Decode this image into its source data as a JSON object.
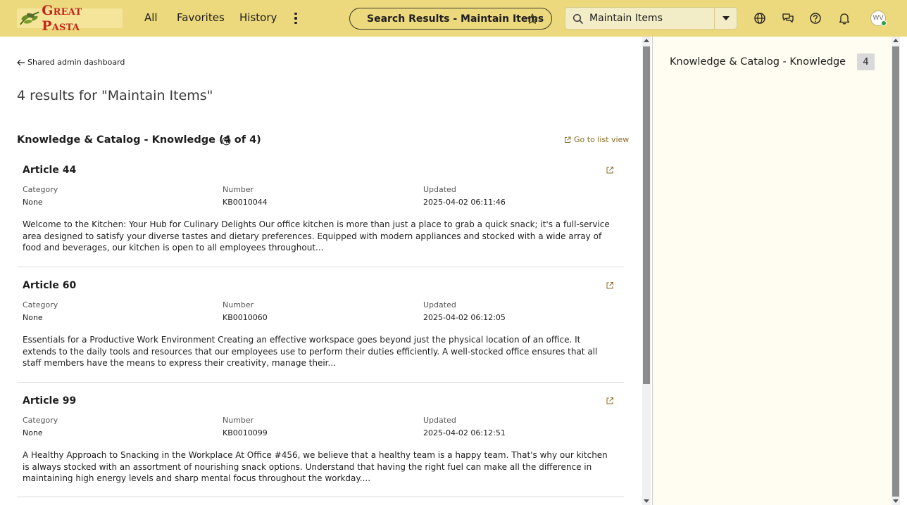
{
  "header": {
    "logo_text": "Great Pasta",
    "nav": [
      "All",
      "Favorites",
      "History"
    ],
    "context_title": "Search Results - Maintain Items",
    "search_value": "Maintain Items",
    "avatar_initials": "WV",
    "colors": {
      "header_bg": "#ecd87d",
      "logo_red": "#c4261b"
    }
  },
  "main": {
    "back_link": "Shared admin dashboard",
    "results_title": "4 results for \"Maintain Items\"",
    "section_title": "Knowledge & Catalog - Knowledge (4 of 4)",
    "list_view_link": "Go to list view",
    "labels": {
      "category": "Category",
      "number": "Number",
      "updated": "Updated"
    },
    "articles": [
      {
        "title": "Article 44",
        "category": "None",
        "number": "KB0010044",
        "updated": "2025-04-02 06:11:46",
        "description": "Welcome to the Kitchen: Your Hub for Culinary Delights Our office kitchen is more than just a place to grab a quick snack; it's a full-service area designed to satisfy your diverse tastes and dietary preferences. Equipped with modern appliances and stocked with a wide array of food and beverages, our kitchen is open to all employees throughout..."
      },
      {
        "title": "Article 60",
        "category": "None",
        "number": "KB0010060",
        "updated": "2025-04-02 06:12:05",
        "description": "Essentials for a Productive Work Environment Creating an effective workspace goes beyond just the physical location of an office. It extends to the daily tools and resources that our employees use to perform their duties efficiently. A well-stocked office ensures that all staff members have the means to express their creativity, manage their..."
      },
      {
        "title": "Article 99",
        "category": "None",
        "number": "KB0010099",
        "updated": "2025-04-02 06:12:51",
        "description": "A Healthy Approach to Snacking in the Workplace At Office #456, we believe that a healthy team is a happy team. That's why our kitchen is always stocked with an assortment of nourishing snack options. Understand that having the right fuel can make all the difference in maintaining high energy levels and sharp mental focus throughout the workday...."
      }
    ]
  },
  "right_panel": {
    "label": "Knowledge & Catalog - Knowledge",
    "count": "4"
  },
  "icons": [
    "leaf-logo-icon",
    "kebab-menu-icon",
    "star-icon",
    "search-icon",
    "caret-down-icon",
    "globe-icon",
    "chat-icon",
    "help-icon",
    "bell-icon",
    "arrow-left-icon",
    "info-icon",
    "external-link-icon"
  ]
}
